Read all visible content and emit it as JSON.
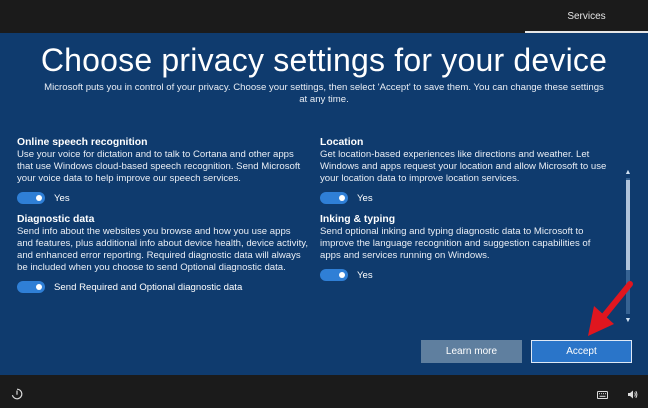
{
  "header": {
    "tab_label": "Services"
  },
  "title": "Choose privacy settings for your device",
  "subtitle": "Microsoft puts you in control of your privacy. Choose your settings, then select 'Accept' to save them. You can change these settings at any time.",
  "settings_left": [
    {
      "title": "Online speech recognition",
      "description": "Use your voice for dictation and to talk to Cortana and other apps that use Windows cloud-based speech recognition. Send Microsoft your voice data to help improve our speech services.",
      "toggle_label": "Yes",
      "enabled": true
    },
    {
      "title": "Diagnostic data",
      "description": "Send info about the websites you browse and how you use apps and features, plus additional info about device health, device activity, and enhanced error reporting. Required diagnostic data will always be included when you choose to send Optional diagnostic data.",
      "toggle_label": "Send Required and Optional diagnostic data",
      "enabled": true
    }
  ],
  "settings_right": [
    {
      "title": "Location",
      "description": "Get location-based experiences like directions and weather. Let Windows and apps request your location and allow Microsoft to use your location data to improve location services.",
      "toggle_label": "Yes",
      "enabled": true
    },
    {
      "title": "Inking & typing",
      "description": "Send optional inking and typing diagnostic data to Microsoft to improve the language recognition and suggestion capabilities of apps and services running on Windows.",
      "toggle_label": "Yes",
      "enabled": true
    }
  ],
  "buttons": {
    "learn_more": "Learn more",
    "accept": "Accept"
  },
  "icons": {
    "ease_of_access": "ease-of-access-icon",
    "keyboard": "keyboard-icon",
    "volume": "volume-icon",
    "scroll_up": "scroll-up-arrow-icon",
    "scroll_down": "scroll-down-arrow-icon",
    "annotation": "red-arrow-icon"
  },
  "colors": {
    "background": "#0f3b6e",
    "bar": "#1b1b1b",
    "toggle_on": "#2f7fd6",
    "accept_button": "#2a75c9",
    "learn_button": "#5f7f9f",
    "annotation_arrow": "#e0161f"
  }
}
